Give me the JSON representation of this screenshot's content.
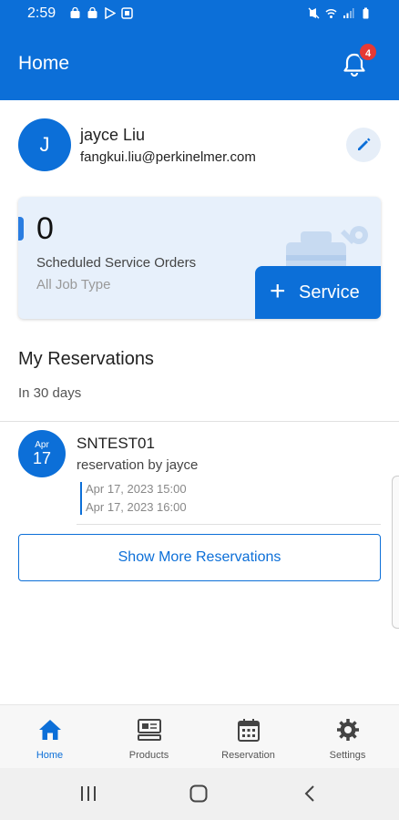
{
  "status_bar": {
    "time": "2:59"
  },
  "app_bar": {
    "title": "Home",
    "notification_count": "4"
  },
  "profile": {
    "initial": "J",
    "name": "jayce Liu",
    "email": "fangkui.liu@perkinelmer.com"
  },
  "service_card": {
    "count": "0",
    "label": "Scheduled Service Orders",
    "sub": "All Job Type",
    "button_label": "Service"
  },
  "reservations": {
    "title": "My Reservations",
    "subtitle": "In 30 days",
    "items": [
      {
        "month": "Apr",
        "day": "17",
        "name": "SNTEST01",
        "description": "reservation by jayce",
        "start": "Apr 17, 2023 15:00",
        "end": "Apr 17, 2023 16:00"
      }
    ],
    "show_more_label": "Show More Reservations"
  },
  "bottom_nav": {
    "items": [
      {
        "label": "Home",
        "icon": "home-icon",
        "active": true
      },
      {
        "label": "Products",
        "icon": "products-icon",
        "active": false
      },
      {
        "label": "Reservation",
        "icon": "calendar-icon",
        "active": false
      },
      {
        "label": "Settings",
        "icon": "gear-icon",
        "active": false
      }
    ]
  },
  "colors": {
    "primary": "#0c6fd8",
    "badge": "#e53935",
    "card_bg": "#e7f0fb"
  }
}
